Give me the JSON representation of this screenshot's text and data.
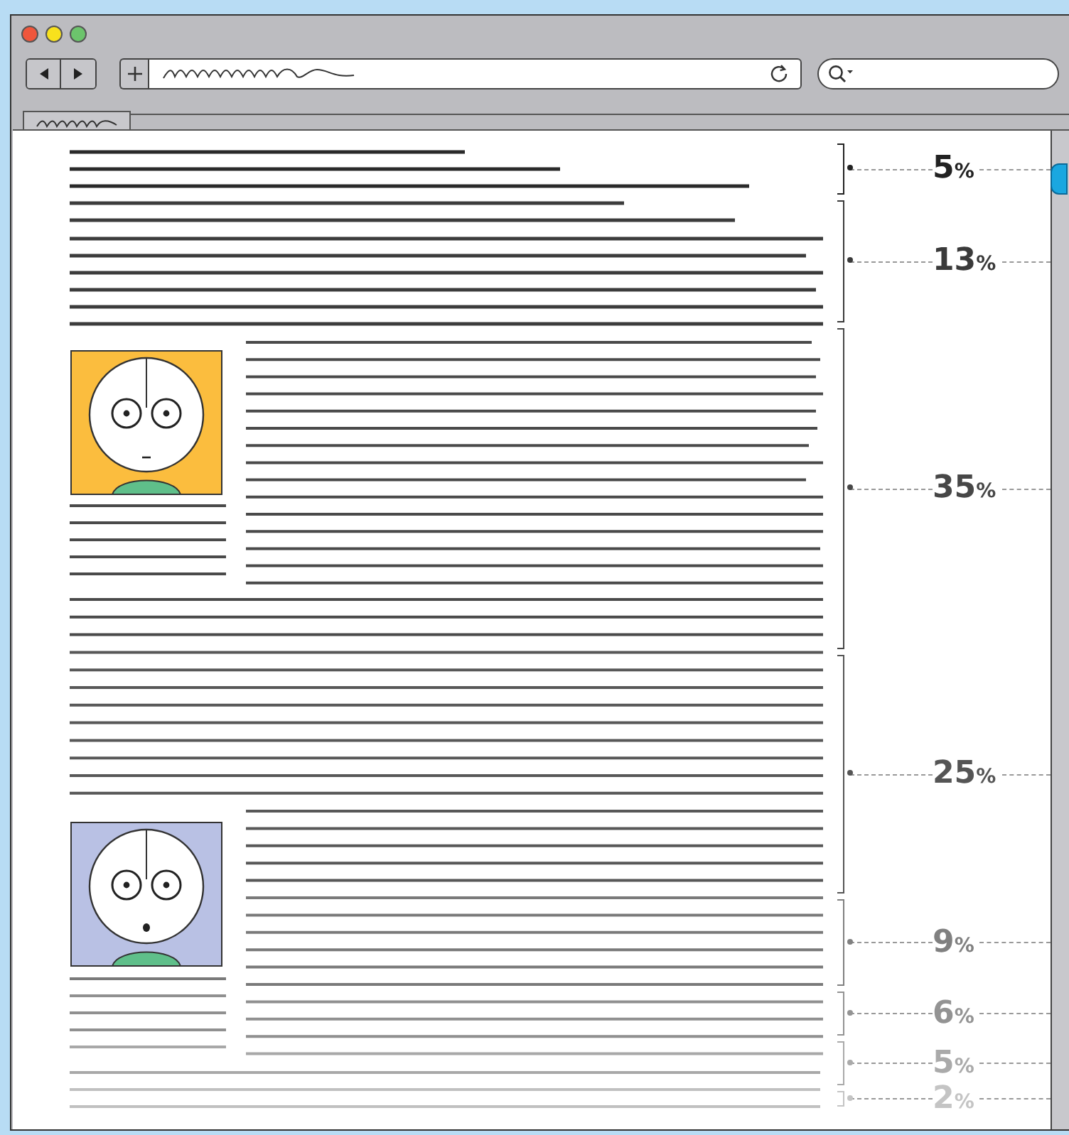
{
  "browser": {
    "tabs": [
      {
        "selected": true
      }
    ]
  },
  "segments": [
    {
      "value": "5",
      "unit": "%",
      "color": "#222222"
    },
    {
      "value": "13",
      "unit": "%",
      "color": "#3a3a3a"
    },
    {
      "value": "35",
      "unit": "%",
      "color": "#474747"
    },
    {
      "value": "25",
      "unit": "%",
      "color": "#555555"
    },
    {
      "value": "9",
      "unit": "%",
      "color": "#808080"
    },
    {
      "value": "6",
      "unit": "%",
      "color": "#939393"
    },
    {
      "value": "5",
      "unit": "%",
      "color": "#aaaaaa"
    },
    {
      "value": "2",
      "unit": "%",
      "color": "#c4c4c4"
    }
  ]
}
